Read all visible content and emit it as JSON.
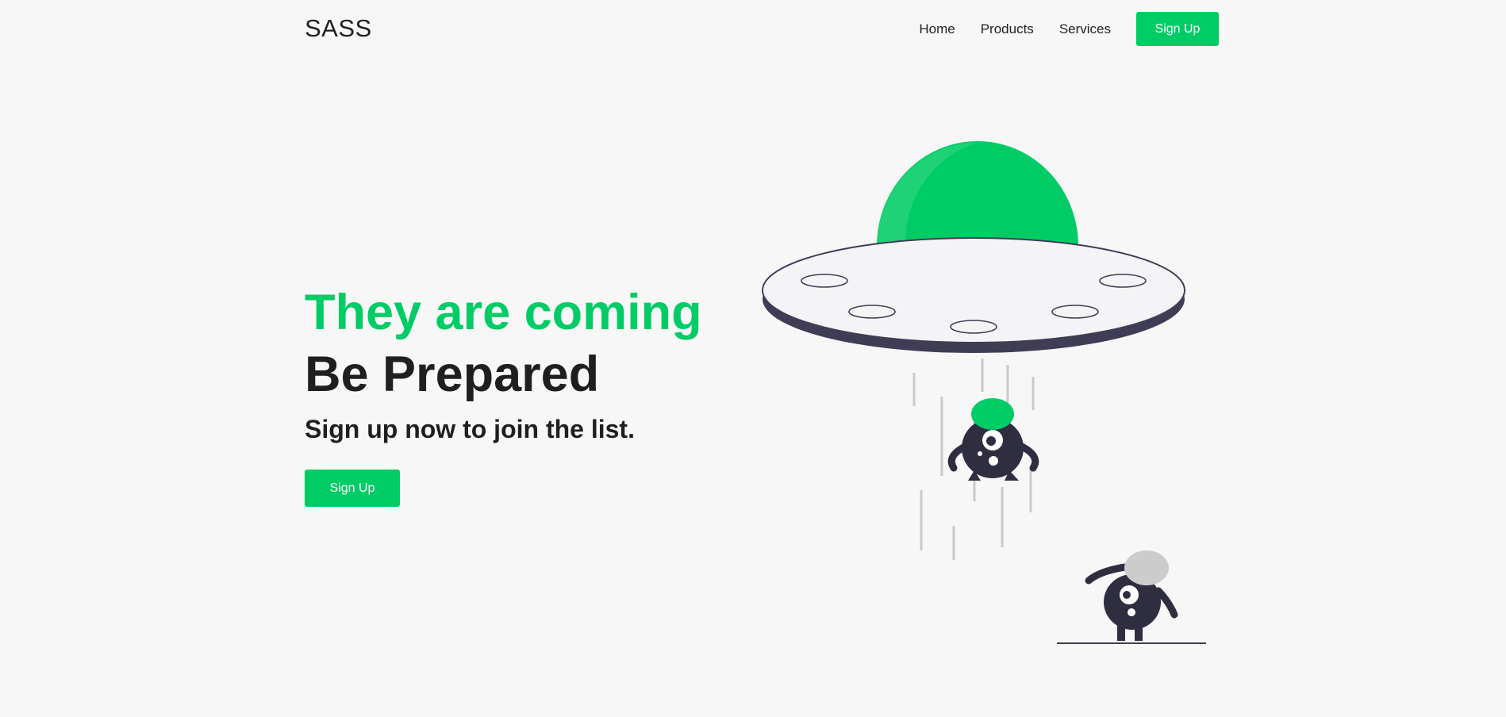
{
  "header": {
    "logo": "SASS",
    "nav": {
      "home": "Home",
      "products": "Products",
      "services": "Services",
      "signup": "Sign Up"
    }
  },
  "hero": {
    "line1": "They are coming",
    "line2": "Be Prepared",
    "subtitle": "Sign up now to join the list.",
    "button": "Sign Up"
  },
  "colors": {
    "accent": "#00cc66",
    "text": "#1f1f1f",
    "background": "#f7f7f7",
    "dark": "#2f2e41"
  },
  "illustration": {
    "icon": "ufo-abduction-illustration"
  }
}
